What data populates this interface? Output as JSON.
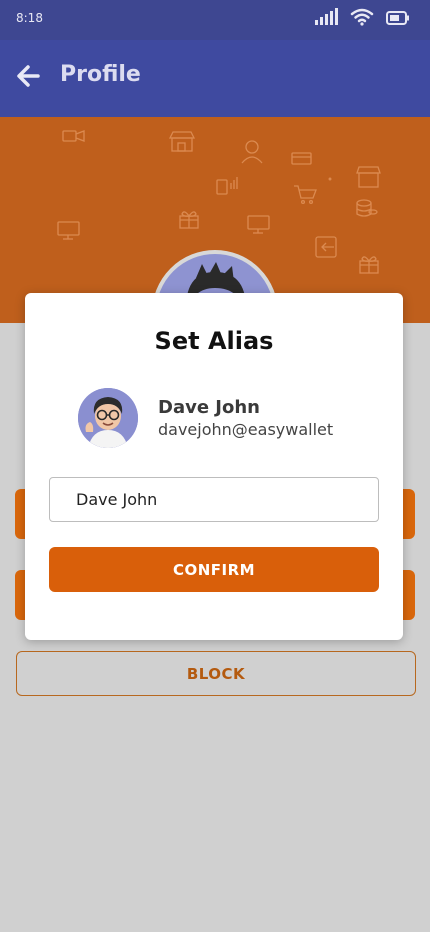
{
  "status_bar": {
    "time": "8:18"
  },
  "app_bar": {
    "title": "Profile"
  },
  "modal": {
    "title": "Set Alias",
    "contact": {
      "name": "Dave John",
      "email": "davejohn@easywallet"
    },
    "alias_input": {
      "value": "Dave John"
    },
    "confirm_label": "CONFIRM"
  },
  "actions": {
    "block_label": "BLOCK"
  },
  "colors": {
    "primary": "#3f4aa0",
    "accent": "#d95f0a",
    "banner": "#bf5f1c",
    "background": "#d0d0d0"
  }
}
